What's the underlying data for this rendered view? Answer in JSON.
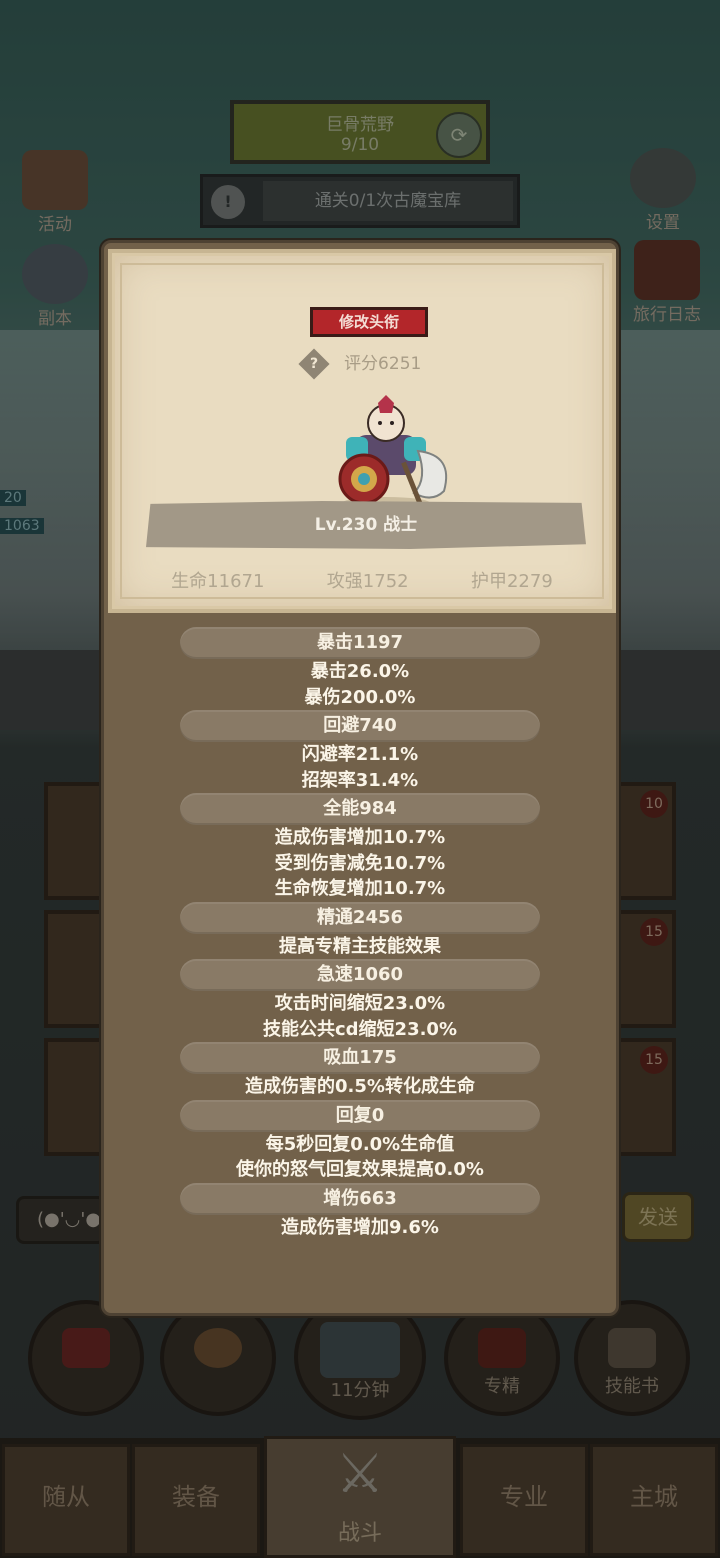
{
  "background": {
    "quest_top": {
      "name": "巨骨荒野",
      "progress": "9/10"
    },
    "quest_bar": {
      "text": "通关0/1次古魔宝库"
    },
    "side_left": [
      {
        "label": "活动"
      },
      {
        "label": "副本"
      }
    ],
    "side_right": [
      {
        "label": "设置"
      },
      {
        "label": "旅行日志"
      }
    ],
    "card_badges": [
      "10",
      "15",
      "15"
    ],
    "chat_emoji": "(●'◡'●",
    "send_label": "发送",
    "skill_row": [
      {
        "label": ""
      },
      {
        "label": ""
      },
      {
        "label": "11分钟"
      },
      {
        "label": "专精"
      },
      {
        "label": "技能书"
      }
    ],
    "tabs": [
      "随从",
      "装备",
      "战斗",
      "专业",
      "主城"
    ],
    "hp_tags": [
      "20",
      "1063"
    ]
  },
  "panel": {
    "title_button": "修改头衔",
    "score": "评分6251",
    "hero_label": "Lv.230 战士",
    "attrs": [
      "生命11671",
      "攻强1752",
      "护甲2279"
    ],
    "stats": [
      {
        "header": "暴击1197",
        "lines": [
          "暴击26.0%",
          "暴伤200.0%"
        ]
      },
      {
        "header": "回避740",
        "lines": [
          "闪避率21.1%",
          "招架率31.4%"
        ]
      },
      {
        "header": "全能984",
        "lines": [
          "造成伤害增加10.7%",
          "受到伤害减免10.7%",
          "生命恢复增加10.7%"
        ]
      },
      {
        "header": "精通2456",
        "lines": [
          "提高专精主技能效果"
        ]
      },
      {
        "header": "急速1060",
        "lines": [
          "攻击时间缩短23.0%",
          "技能公共cd缩短23.0%"
        ]
      },
      {
        "header": "吸血175",
        "lines": [
          "造成伤害的0.5%转化成生命"
        ]
      },
      {
        "header": "回复0",
        "lines": [
          "每5秒回复0.0%生命值",
          "使你的怒气回复效果提高0.0%"
        ]
      },
      {
        "header": "增伤663",
        "lines": [
          "造成伤害增加9.6%"
        ]
      }
    ]
  },
  "colors": {
    "panel_brown": "#72614a",
    "paper": "#e9dcc1",
    "title_red": "#b3262a",
    "pill": "#897a66"
  }
}
